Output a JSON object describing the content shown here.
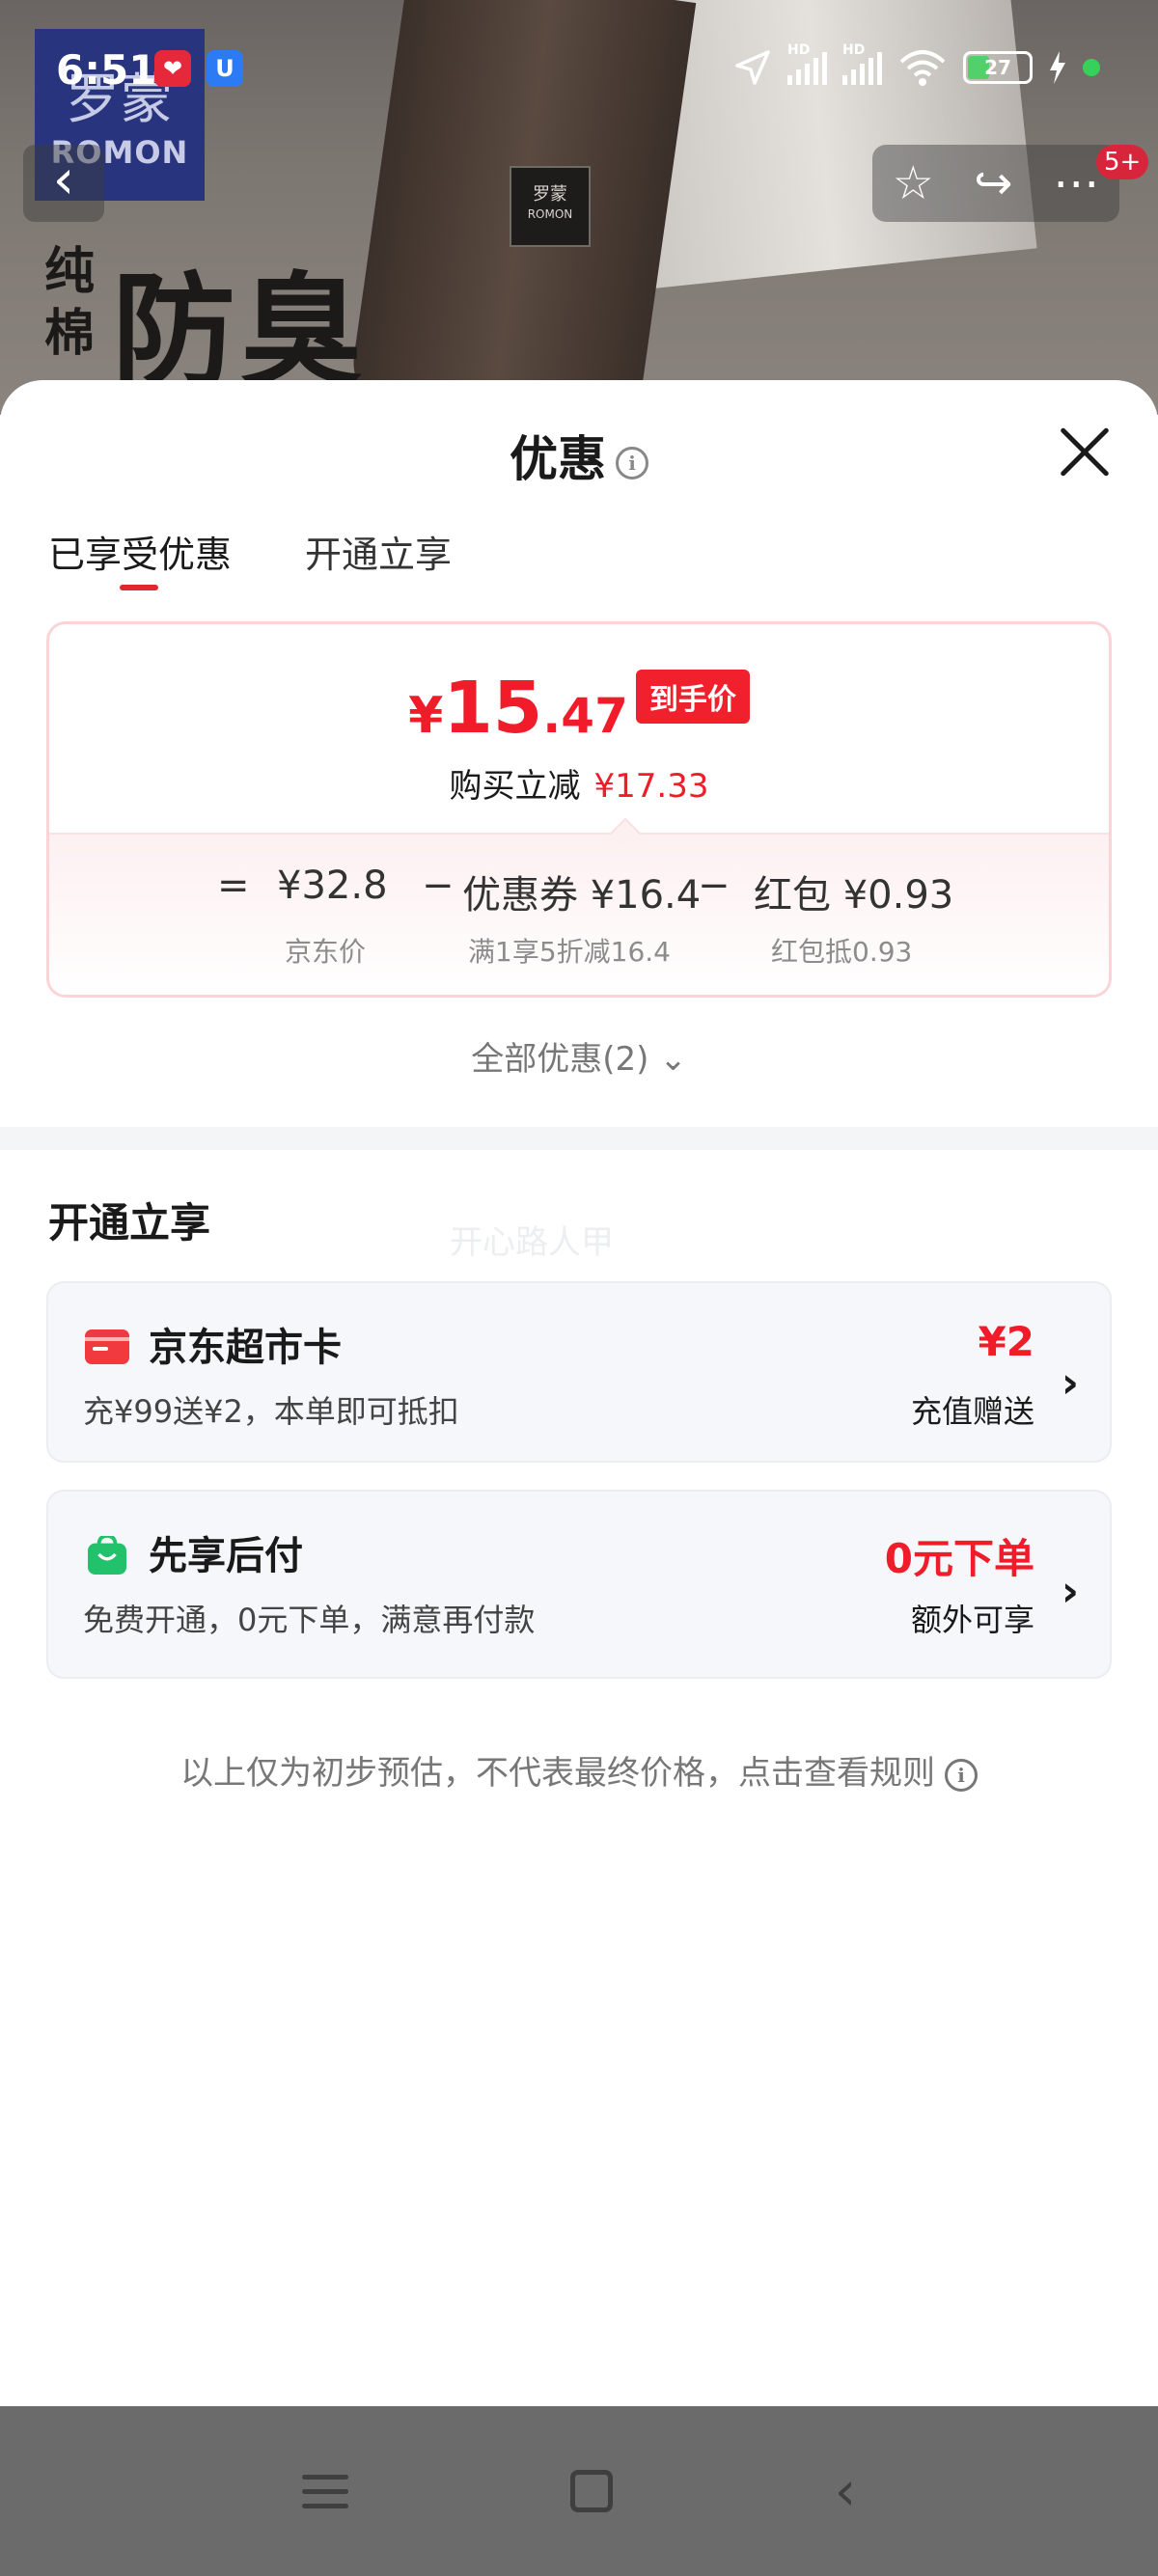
{
  "status_bar": {
    "time": "6:51",
    "battery_level": "27",
    "signal_label_1": "HD",
    "signal_label_2": "HD"
  },
  "banner": {
    "logo_cn": "罗蒙",
    "logo_en": "ROMON",
    "tag_cn": "罗蒙",
    "tag_en": "ROMON",
    "slogan_small": "纯棉",
    "slogan_big": "防臭",
    "cart_badge": "5+"
  },
  "sheet": {
    "title": "优惠",
    "info_glyph": "i",
    "tabs": [
      {
        "label": "已享受优惠"
      },
      {
        "label": "开通立享"
      }
    ],
    "price_card": {
      "currency": "¥",
      "price_int": "15",
      "price_dec": ".47",
      "price_tag": "到手价",
      "instant_cut_label": "购买立减",
      "instant_cut_amount": "¥17.33",
      "equation": {
        "equals": "=",
        "jd_price": "¥32.8",
        "jd_price_label": "京东价",
        "minus1": "−",
        "coupon": "优惠券 ¥16.4",
        "coupon_label": "满1享5折减16.4",
        "minus2": "−",
        "red_packet": "红包 ¥0.93",
        "red_packet_label": "红包抵0.93"
      }
    },
    "all_offers": "全部优惠(2)",
    "all_offers_chevron": "⌄",
    "section_title": "开通立享",
    "watermark": "开心路人甲",
    "offers": [
      {
        "title": "京东超市卡",
        "desc": "充¥99送¥2，本单即可抵扣",
        "value": "¥2",
        "note": "充值赠送",
        "arrow": "›"
      },
      {
        "title": "先享后付",
        "desc": "免费开通，0元下单，满意再付款",
        "value": "0元下单",
        "note": "额外可享",
        "arrow": "›"
      }
    ],
    "disclaimer": "以上仅为初步预估，不代表最终价格，点击查看规则"
  },
  "colors": {
    "accent_red": "#f01c2a",
    "supermarket_card_icon": "#f03a3f",
    "pay_later_icon": "#22c16b"
  }
}
